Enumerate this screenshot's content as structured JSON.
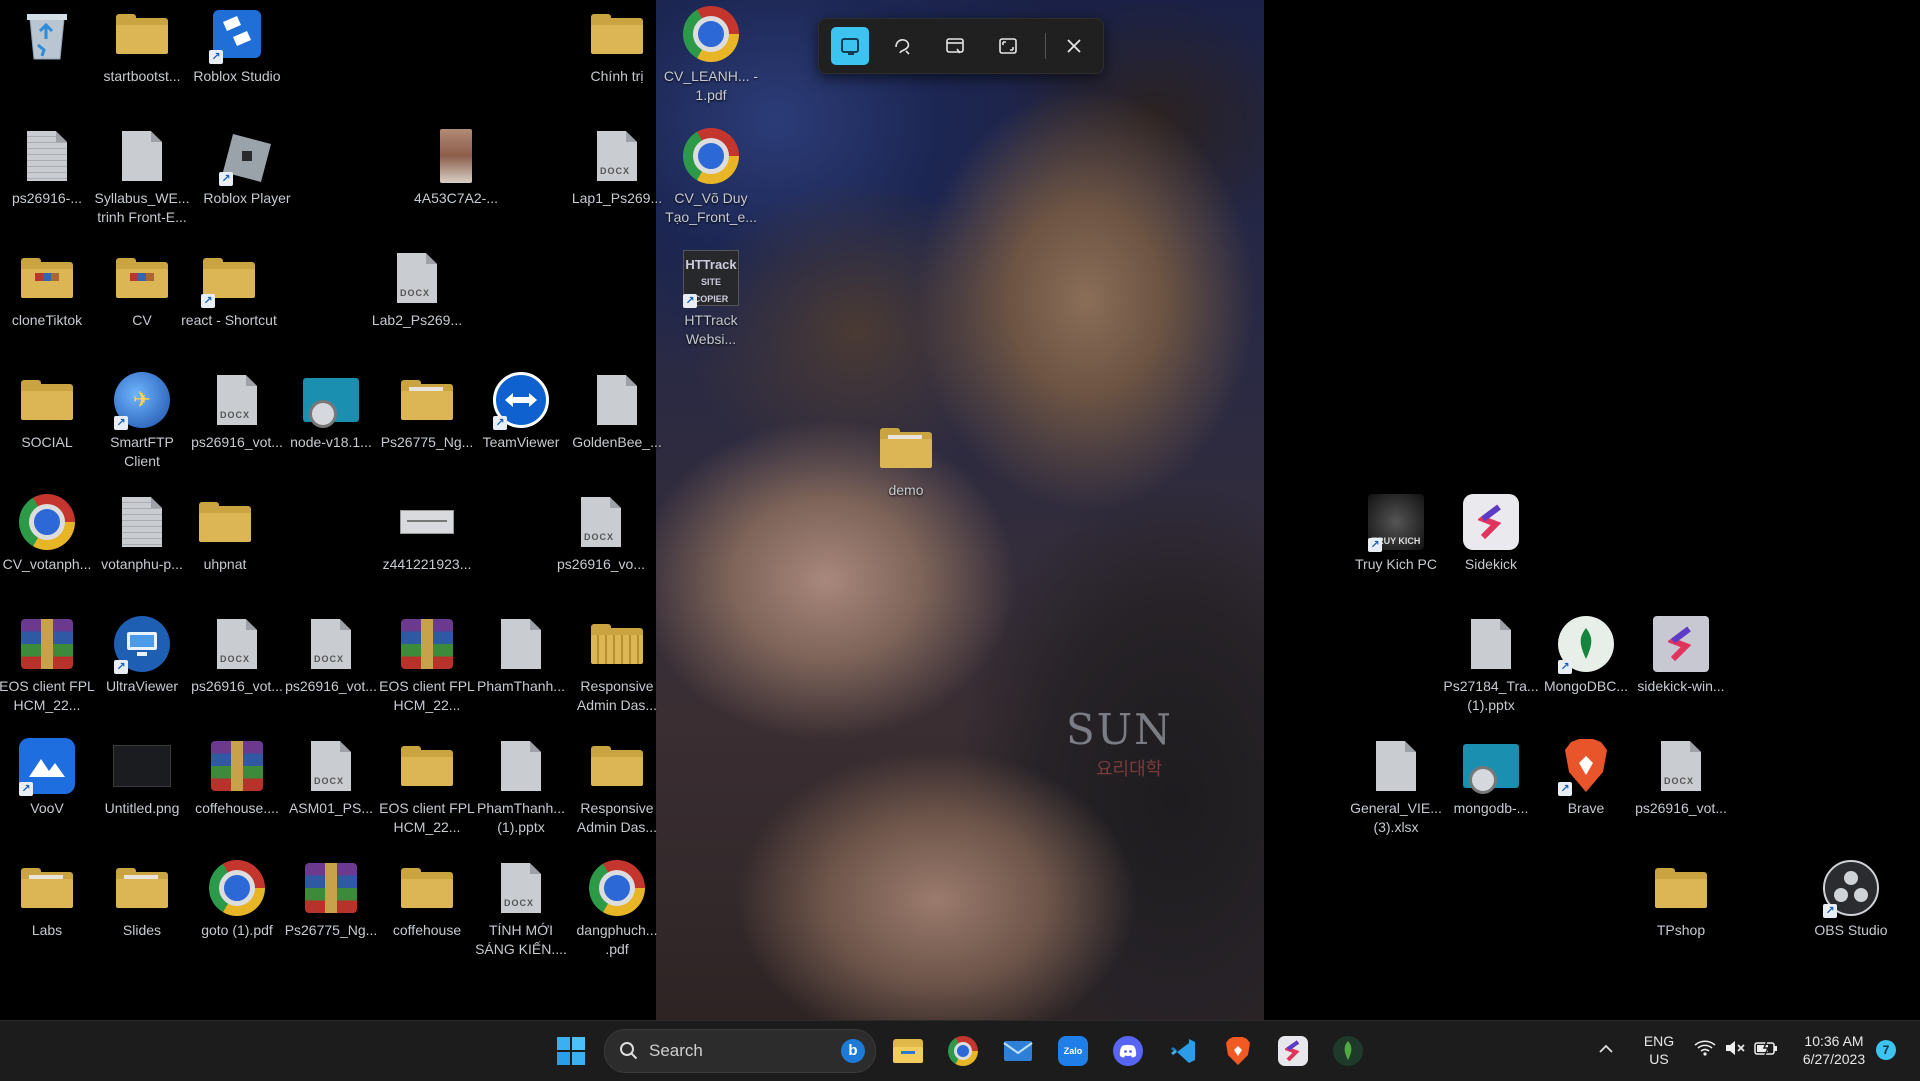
{
  "desktop": {
    "icons": [
      {
        "label": "",
        "kind": "recycle"
      },
      {
        "label": "startbootst...",
        "kind": "folder"
      },
      {
        "label": "Roblox Studio",
        "kind": "roblox-studio"
      },
      {
        "label": "Chính trị",
        "kind": "folder"
      },
      {
        "label": "CV_LEANH... - 1.pdf",
        "kind": "chrome"
      },
      {
        "label": "ps26916-...",
        "kind": "doc-lined"
      },
      {
        "label": "Syllabus_WE... trinh Front-E...",
        "kind": "doc"
      },
      {
        "label": "Roblox Player",
        "kind": "roblox"
      },
      {
        "label": "4A53C7A2-...",
        "kind": "photo"
      },
      {
        "label": "Lap1_Ps269...",
        "kind": "docx"
      },
      {
        "label": "CV_Võ Duy Tạo_Front_e...",
        "kind": "chrome"
      },
      {
        "label": "cloneTiktok",
        "kind": "folder-pics"
      },
      {
        "label": "CV",
        "kind": "folder-pics"
      },
      {
        "label": "react - Shortcut",
        "kind": "folder"
      },
      {
        "label": "Lab2_Ps269...",
        "kind": "docx"
      },
      {
        "label": "HTTrack Websi...",
        "kind": "httrack"
      },
      {
        "label": "SOCIAL",
        "kind": "folder"
      },
      {
        "label": "SmartFTP Client",
        "kind": "smartftp"
      },
      {
        "label": "ps26916_vot...",
        "kind": "docx"
      },
      {
        "label": "node-v18.1...",
        "kind": "installer"
      },
      {
        "label": "Ps26775_Ng...",
        "kind": "folder-paper"
      },
      {
        "label": "TeamViewer",
        "kind": "teamviewer"
      },
      {
        "label": "GoldenBee_...",
        "kind": "doc"
      },
      {
        "label": "demo",
        "kind": "folder-paper"
      },
      {
        "label": "CV_votanph...",
        "kind": "chrome"
      },
      {
        "label": "votanphu-p...",
        "kind": "doc-lined"
      },
      {
        "label": "uhpnat",
        "kind": "folder"
      },
      {
        "label": "z441221923...",
        "kind": "image"
      },
      {
        "label": "ps26916_vo...",
        "kind": "docx"
      },
      {
        "label": "EOS client FPL HCM_22...",
        "kind": "rar"
      },
      {
        "label": "UltraViewer",
        "kind": "ultraviewer"
      },
      {
        "label": "ps26916_vot...",
        "kind": "docx"
      },
      {
        "label": "ps26916_vot...",
        "kind": "docx"
      },
      {
        "label": "EOS client FPL HCM_22...",
        "kind": "rar"
      },
      {
        "label": "PhamThanh...",
        "kind": "doc"
      },
      {
        "label": "Responsive Admin Das...",
        "kind": "folder-zip"
      },
      {
        "label": "VooV",
        "kind": "voov"
      },
      {
        "label": "Untitled.png",
        "kind": "image-dark"
      },
      {
        "label": "coffehouse....",
        "kind": "rar"
      },
      {
        "label": "ASM01_PS...",
        "kind": "docx"
      },
      {
        "label": "EOS client FPL HCM_22...",
        "kind": "folder"
      },
      {
        "label": "PhamThanh... (1).pptx",
        "kind": "doc"
      },
      {
        "label": "Responsive Admin Das...",
        "kind": "folder"
      },
      {
        "label": "Labs",
        "kind": "folder-paper"
      },
      {
        "label": "Slides",
        "kind": "folder-paper"
      },
      {
        "label": "goto (1).pdf",
        "kind": "chrome"
      },
      {
        "label": "Ps26775_Ng...",
        "kind": "rar"
      },
      {
        "label": "coffehouse",
        "kind": "folder"
      },
      {
        "label": "TÍNH MỚI SÁNG KIẾN....",
        "kind": "docx"
      },
      {
        "label": "dangphuch... .pdf",
        "kind": "chrome"
      },
      {
        "label": "Truy Kich PC",
        "kind": "truykich"
      },
      {
        "label": "Sidekick",
        "kind": "sidekick"
      },
      {
        "label": "Ps27184_Tra... (1).pptx",
        "kind": "doc"
      },
      {
        "label": "MongoDBC...",
        "kind": "mongo"
      },
      {
        "label": "sidekick-win...",
        "kind": "sidekick-installer"
      },
      {
        "label": "General_VIE... (3).xlsx",
        "kind": "doc"
      },
      {
        "label": "mongodb-...",
        "kind": "installer"
      },
      {
        "label": "Brave",
        "kind": "brave"
      },
      {
        "label": "ps26916_vot...",
        "kind": "docx"
      },
      {
        "label": "TPshop",
        "kind": "folder"
      },
      {
        "label": "OBS Studio",
        "kind": "obs"
      }
    ],
    "wallpaper_print": "SUN",
    "wallpaper_print_sub": "요리대학"
  },
  "snipping_toolbar": {
    "tools": [
      "rectangle-mode-icon",
      "freeform-mode-icon",
      "window-mode-icon",
      "fullscreen-mode-icon"
    ],
    "active": "rectangle-mode-icon",
    "accent": "#3cc3ef"
  },
  "taskbar": {
    "search_placeholder": "Search",
    "pinned": [
      "File Explorer",
      "Chrome",
      "Mail",
      "Zalo",
      "Discord",
      "Visual Studio Code",
      "Brave",
      "Sidekick",
      "MongoDB Compass"
    ],
    "language": "ENG",
    "region": "US",
    "time": "10:36 AM",
    "date": "6/27/2023",
    "notification_count": "7"
  }
}
